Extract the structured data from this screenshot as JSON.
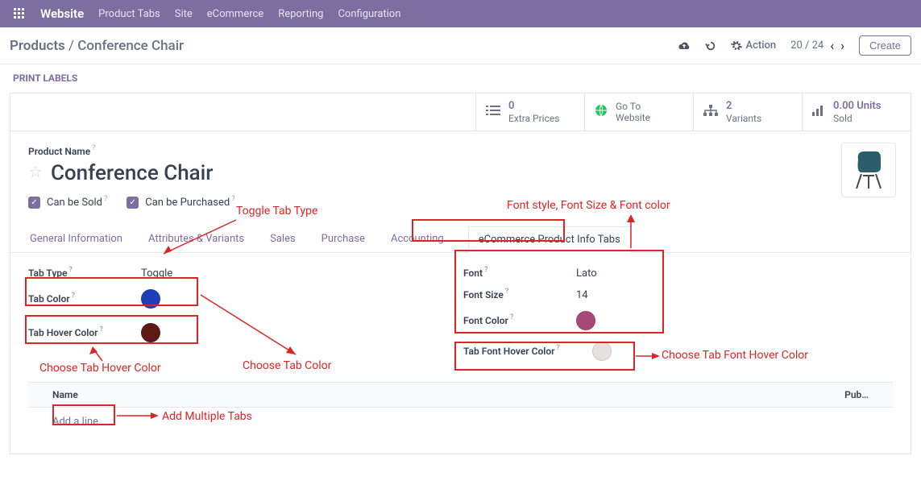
{
  "topbar": {
    "brand": "Website",
    "menu": [
      "Product Tabs",
      "Site",
      "eCommerce",
      "Reporting",
      "Configuration"
    ]
  },
  "breadcrumb": {
    "parent": "Products",
    "sep": " / ",
    "current": "Conference Chair",
    "action_label": "Action",
    "pager": "20 / 24",
    "create_label": "Create"
  },
  "subactions": {
    "print_labels": "PRINT LABELS"
  },
  "stats": {
    "extra_prices": {
      "value": "0",
      "label": "Extra Prices"
    },
    "goto_website": {
      "value": "Go To",
      "label": "Website"
    },
    "variants": {
      "value": "2",
      "label": "Variants"
    },
    "sold": {
      "value": "0.00 Units",
      "label": "Sold"
    }
  },
  "product": {
    "name_label": "Product Name",
    "name": "Conference Chair",
    "can_sold": "Can be Sold",
    "can_purchased": "Can be Purchased"
  },
  "tabs": [
    "General Information",
    "Attributes & Variants",
    "Sales",
    "Purchase",
    "Accounting",
    "eCommerce Product Info Tabs"
  ],
  "settings": {
    "tab_type_label": "Tab Type",
    "tab_type_value": "Toggle",
    "tab_color_label": "Tab Color",
    "tab_color_value": "#1F3FB8",
    "tab_hover_label": "Tab Hover Color",
    "tab_hover_value": "#5C1A17",
    "font_label": "Font",
    "font_value": "Lato",
    "font_size_label": "Font Size",
    "font_size_value": "14",
    "font_color_label": "Font Color",
    "font_color_value": "#A84879",
    "tab_font_hover_label": "Tab Font Hover Color",
    "tab_font_hover_value": "#E7E0DD"
  },
  "table": {
    "col_name": "Name",
    "col_pub": "Pub…",
    "add_line": "Add a line"
  },
  "annotations": {
    "toggle": "Toggle Tab Type",
    "font_group": "Font style, Font Size & Font color",
    "choose_hover": "Choose Tab Hover Color",
    "choose_color": "Choose Tab Color",
    "choose_font_hover": "Choose Tab Font Hover Color",
    "add_tabs": "Add Multiple Tabs"
  },
  "q": "?"
}
